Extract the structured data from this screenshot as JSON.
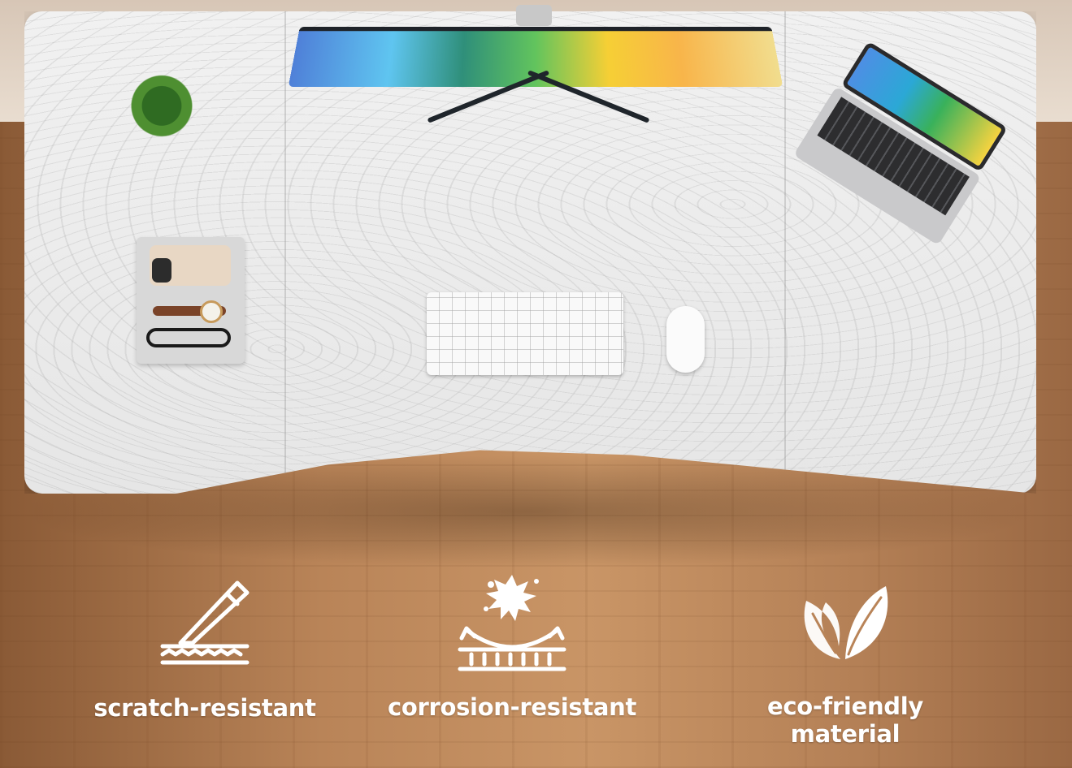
{
  "features": [
    {
      "icon": "scratch-resistant-icon",
      "label": "scratch-resistant"
    },
    {
      "icon": "corrosion-resistant-icon",
      "label": "corrosion-resistant"
    },
    {
      "icon": "eco-friendly-leaf-icon",
      "label": "eco-friendly material"
    }
  ],
  "colors": {
    "desk_top": "#ececec",
    "floor": "#b98458",
    "icon_and_text": "#ffffff"
  }
}
